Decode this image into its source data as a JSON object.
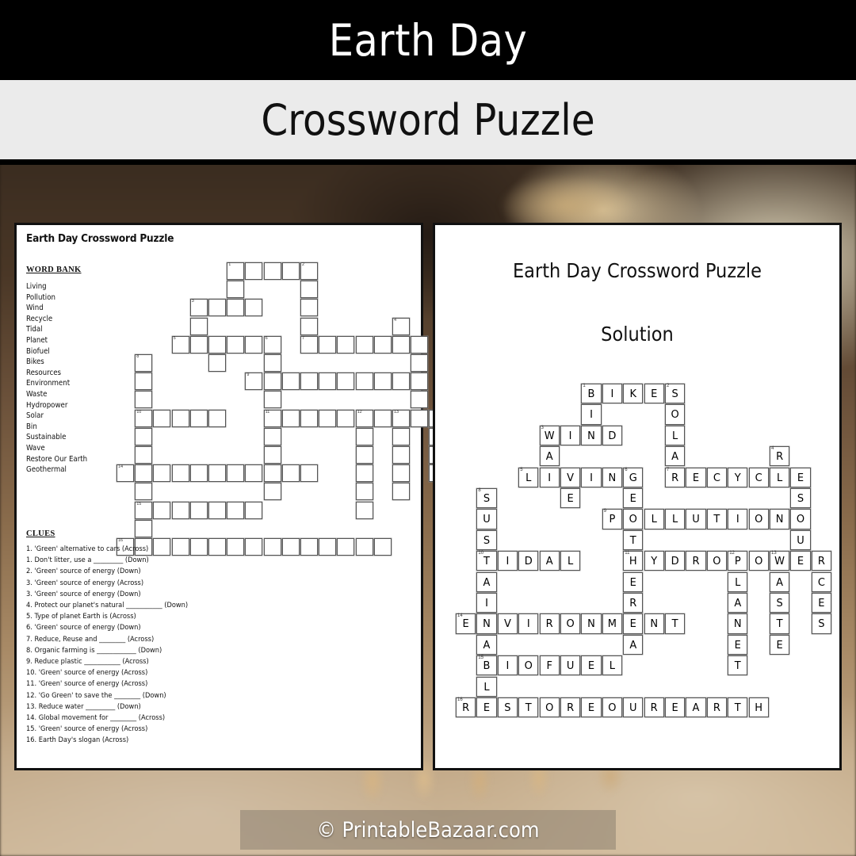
{
  "header": {
    "title": "Earth Day",
    "subtitle": "Crossword Puzzle",
    "title_bg": "#000000",
    "subtitle_bg": "#ebebeb"
  },
  "left_page": {
    "title": "Earth Day Crossword Puzzle",
    "word_bank_heading": "WORD BANK",
    "word_bank": [
      "Living",
      "Pollution",
      "Wind",
      "Recycle",
      "Tidal",
      "Planet",
      "Biofuel",
      "Bikes",
      "Resources",
      "Environment",
      "Waste",
      "Hydropower",
      "Solar",
      "Bin",
      "Sustainable",
      "Wave",
      "Restore Our Earth",
      "Geothermal"
    ],
    "clues_heading": "CLUES",
    "clues": [
      "1. 'Green' alternative to cars (Across)",
      "1. Don't litter, use a _________ (Down)",
      "2. 'Green' source of energy (Down)",
      "3. 'Green' source of energy (Across)",
      "3. 'Green' source of energy (Down)",
      "4. Protect our planet's natural ___________ (Down)",
      "5. Type of planet Earth is (Across)",
      "6. 'Green' source of energy (Down)",
      "7. Reduce, Reuse and ________ (Across)",
      "8. Organic farming is ____________ (Down)",
      "9. Reduce plastic ___________ (Across)",
      "10. 'Green' source of energy (Across)",
      "11. 'Green' source of energy (Across)",
      "12. 'Go Green' to save the ________ (Down)",
      "13. Reduce water _________ (Down)",
      "14. Global movement for ________ (Across)",
      "15. 'Green' source of energy (Across)",
      "16. Earth Day's slogan (Across)"
    ]
  },
  "right_page": {
    "title": "Earth Day Crossword Puzzle",
    "subtitle": "Solution"
  },
  "crossword": {
    "rows": 16,
    "cols": 15,
    "cells": [
      {
        "r": 0,
        "c": 5,
        "l": "B",
        "n": "1"
      },
      {
        "r": 0,
        "c": 6,
        "l": "I"
      },
      {
        "r": 0,
        "c": 7,
        "l": "K"
      },
      {
        "r": 0,
        "c": 8,
        "l": "E"
      },
      {
        "r": 0,
        "c": 9,
        "l": "S",
        "n": "2"
      },
      {
        "r": 1,
        "c": 5,
        "l": "I"
      },
      {
        "r": 1,
        "c": 9,
        "l": "O"
      },
      {
        "r": 2,
        "c": 3,
        "l": "W",
        "n": "3"
      },
      {
        "r": 2,
        "c": 4,
        "l": "I"
      },
      {
        "r": 2,
        "c": 5,
        "l": "N"
      },
      {
        "r": 2,
        "c": 6,
        "l": "D"
      },
      {
        "r": 2,
        "c": 9,
        "l": "L"
      },
      {
        "r": 3,
        "c": 3,
        "l": "A"
      },
      {
        "r": 3,
        "c": 9,
        "l": "A"
      },
      {
        "r": 3,
        "c": 14,
        "l": "R",
        "n": "4"
      },
      {
        "r": 4,
        "c": 2,
        "l": "L",
        "n": "5"
      },
      {
        "r": 4,
        "c": 3,
        "l": "I"
      },
      {
        "r": 4,
        "c": 4,
        "l": "V"
      },
      {
        "r": 4,
        "c": 5,
        "l": "I"
      },
      {
        "r": 4,
        "c": 6,
        "l": "N"
      },
      {
        "r": 4,
        "c": 7,
        "l": "G",
        "n": "6"
      },
      {
        "r": 4,
        "c": 9,
        "l": "R",
        "n": "7"
      },
      {
        "r": 4,
        "c": 10,
        "l": "E"
      },
      {
        "r": 4,
        "c": 11,
        "l": "C"
      },
      {
        "r": 4,
        "c": 12,
        "l": "Y"
      },
      {
        "r": 4,
        "c": 13,
        "l": "C"
      },
      {
        "r": 4,
        "c": 14,
        "l": "L"
      },
      {
        "r": 4,
        "c": 15,
        "l": "E"
      },
      {
        "r": 5,
        "c": 0,
        "l": "S",
        "n": "8"
      },
      {
        "r": 5,
        "c": 4,
        "l": "E"
      },
      {
        "r": 5,
        "c": 7,
        "l": "E"
      },
      {
        "r": 5,
        "c": 15,
        "l": "S"
      },
      {
        "r": 6,
        "c": 0,
        "l": "U"
      },
      {
        "r": 6,
        "c": 6,
        "l": "P",
        "n": "9"
      },
      {
        "r": 6,
        "c": 7,
        "l": "O"
      },
      {
        "r": 6,
        "c": 8,
        "l": "L"
      },
      {
        "r": 6,
        "c": 9,
        "l": "L"
      },
      {
        "r": 6,
        "c": 10,
        "l": "U"
      },
      {
        "r": 6,
        "c": 11,
        "l": "T"
      },
      {
        "r": 6,
        "c": 12,
        "l": "I"
      },
      {
        "r": 6,
        "c": 13,
        "l": "O"
      },
      {
        "r": 6,
        "c": 14,
        "l": "N"
      },
      {
        "r": 6,
        "c": 15,
        "l": "O"
      },
      {
        "r": 7,
        "c": 0,
        "l": "S"
      },
      {
        "r": 7,
        "c": 7,
        "l": "T"
      },
      {
        "r": 7,
        "c": 15,
        "l": "U"
      },
      {
        "r": 8,
        "c": 0,
        "l": "T",
        "n": "10"
      },
      {
        "r": 8,
        "c": 1,
        "l": "I"
      },
      {
        "r": 8,
        "c": 2,
        "l": "D"
      },
      {
        "r": 8,
        "c": 3,
        "l": "A"
      },
      {
        "r": 8,
        "c": 4,
        "l": "L"
      },
      {
        "r": 8,
        "c": 7,
        "l": "H",
        "n": "11"
      },
      {
        "r": 8,
        "c": 8,
        "l": "Y"
      },
      {
        "r": 8,
        "c": 9,
        "l": "D"
      },
      {
        "r": 8,
        "c": 10,
        "l": "R"
      },
      {
        "r": 8,
        "c": 11,
        "l": "O"
      },
      {
        "r": 8,
        "c": 12,
        "l": "P",
        "n": "12"
      },
      {
        "r": 8,
        "c": 13,
        "l": "O"
      },
      {
        "r": 8,
        "c": 14,
        "l": "W",
        "n": "13"
      },
      {
        "r": 8,
        "c": 15,
        "l": "E"
      },
      {
        "r": 8,
        "c": 16,
        "l": "R"
      },
      {
        "r": 9,
        "c": 0,
        "l": "A"
      },
      {
        "r": 9,
        "c": 7,
        "l": "E"
      },
      {
        "r": 9,
        "c": 12,
        "l": "L"
      },
      {
        "r": 9,
        "c": 14,
        "l": "A"
      },
      {
        "r": 9,
        "c": 16,
        "l": "C"
      },
      {
        "r": 10,
        "c": 0,
        "l": "I"
      },
      {
        "r": 10,
        "c": 7,
        "l": "R"
      },
      {
        "r": 10,
        "c": 12,
        "l": "A"
      },
      {
        "r": 10,
        "c": 14,
        "l": "S"
      },
      {
        "r": 10,
        "c": 16,
        "l": "E"
      },
      {
        "r": 11,
        "c": -1,
        "l": "E",
        "n": "14"
      },
      {
        "r": 11,
        "c": 0,
        "l": "N"
      },
      {
        "r": 11,
        "c": 1,
        "l": "V"
      },
      {
        "r": 11,
        "c": 2,
        "l": "I"
      },
      {
        "r": 11,
        "c": 3,
        "l": "R"
      },
      {
        "r": 11,
        "c": 4,
        "l": "O"
      },
      {
        "r": 11,
        "c": 5,
        "l": "N"
      },
      {
        "r": 11,
        "c": 6,
        "l": "M"
      },
      {
        "r": 11,
        "c": 7,
        "l": "E"
      },
      {
        "r": 11,
        "c": 8,
        "l": "N"
      },
      {
        "r": 11,
        "c": 9,
        "l": "T"
      },
      {
        "r": 11,
        "c": 12,
        "l": "N"
      },
      {
        "r": 11,
        "c": 14,
        "l": "T"
      },
      {
        "r": 11,
        "c": 16,
        "l": "S"
      },
      {
        "r": 12,
        "c": 0,
        "l": "A"
      },
      {
        "r": 12,
        "c": 7,
        "l": "A"
      },
      {
        "r": 12,
        "c": 12,
        "l": "E"
      },
      {
        "r": 12,
        "c": 14,
        "l": "E"
      },
      {
        "r": 13,
        "c": 0,
        "l": "B",
        "n": "15"
      },
      {
        "r": 13,
        "c": 1,
        "l": "I"
      },
      {
        "r": 13,
        "c": 2,
        "l": "O"
      },
      {
        "r": 13,
        "c": 3,
        "l": "F"
      },
      {
        "r": 13,
        "c": 4,
        "l": "U"
      },
      {
        "r": 13,
        "c": 5,
        "l": "E"
      },
      {
        "r": 13,
        "c": 6,
        "l": "L"
      },
      {
        "r": 13,
        "c": 12,
        "l": "T"
      },
      {
        "r": 14,
        "c": 0,
        "l": "L"
      },
      {
        "r": 15,
        "c": -1,
        "l": "R",
        "n": "16"
      },
      {
        "r": 15,
        "c": 0,
        "l": "E"
      },
      {
        "r": 15,
        "c": 1,
        "l": "S"
      },
      {
        "r": 15,
        "c": 2,
        "l": "T"
      },
      {
        "r": 15,
        "c": 3,
        "l": "O"
      },
      {
        "r": 15,
        "c": 4,
        "l": "R"
      },
      {
        "r": 15,
        "c": 5,
        "l": "E"
      },
      {
        "r": 15,
        "c": 6,
        "l": "O"
      },
      {
        "r": 15,
        "c": 7,
        "l": "U"
      },
      {
        "r": 15,
        "c": 8,
        "l": "R"
      },
      {
        "r": 15,
        "c": 9,
        "l": "E"
      },
      {
        "r": 15,
        "c": 10,
        "l": "A"
      },
      {
        "r": 15,
        "c": 11,
        "l": "R"
      },
      {
        "r": 15,
        "c": 12,
        "l": "T"
      },
      {
        "r": 15,
        "c": 13,
        "l": "H"
      }
    ]
  },
  "watermark": {
    "text": "© PrintableBazaar.com"
  }
}
